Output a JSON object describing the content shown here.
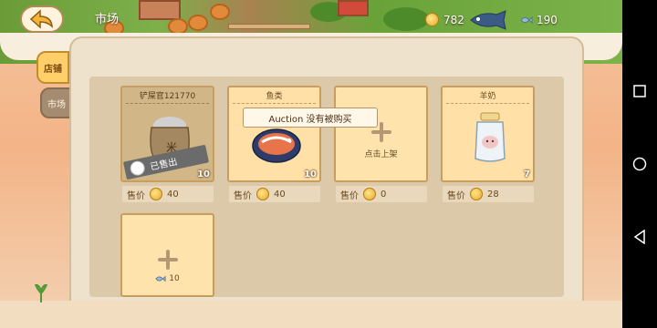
{
  "header": {
    "title": "市场",
    "coins": "782",
    "fish": "190"
  },
  "tabs": [
    {
      "label": "店铺",
      "active": true
    },
    {
      "label": "市场",
      "active": false
    }
  ],
  "slots": [
    {
      "title": "铲屎官121770",
      "quantity": "10",
      "status": "已售出",
      "price_label": "售价",
      "price": "40",
      "item_icon": "rice-sack-icon"
    },
    {
      "title": "鱼类",
      "quantity": "10",
      "status": "",
      "price_label": "售价",
      "price": "40",
      "item_icon": "fish-platter-icon"
    },
    {
      "title": "",
      "quantity": "",
      "status": "",
      "action_label": "点击上架",
      "price_label": "售价",
      "price": "0",
      "item_icon": "plus-icon"
    },
    {
      "title": "羊奶",
      "quantity": "7",
      "status": "",
      "price_label": "售价",
      "price": "28",
      "item_icon": "milk-jar-icon"
    },
    {
      "unlock_cost": "10",
      "item_icon": "plus-icon"
    }
  ],
  "tooltip": "Auction 没有被购买",
  "colors": {
    "card_bg": "#ffe0a6",
    "card_border": "#c99d5e",
    "tab_active": "#ffcf6a",
    "tab_inactive": "#a58c70",
    "panel_bg": "#efe2cc"
  }
}
